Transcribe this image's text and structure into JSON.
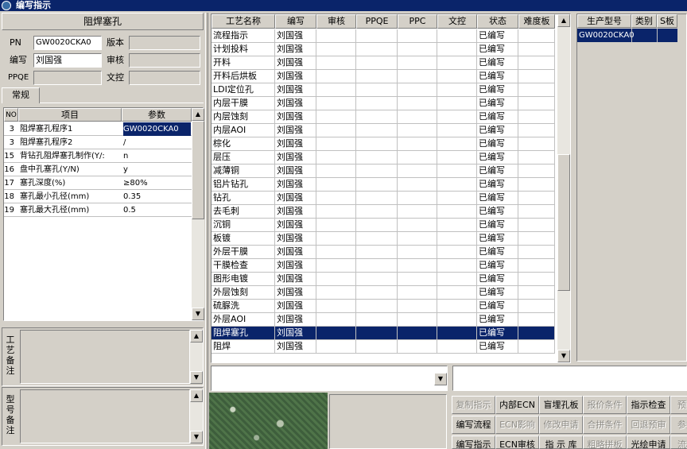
{
  "window": {
    "title": "编写指示"
  },
  "left": {
    "header": "阻焊塞孔",
    "fields": {
      "pn_label": "PN",
      "pn_value": "GW0020CKA0",
      "version_label": "版本",
      "version_value": "",
      "author_label": "编写",
      "author_value": "刘国强",
      "review_label": "审核",
      "review_value": "",
      "ppqe_label": "PPQE",
      "ppqe_value": "",
      "doc_label": "文控",
      "doc_value": ""
    },
    "tab": "常规",
    "param_table": {
      "headers": [
        "NO",
        "项目",
        "参数"
      ],
      "rows": [
        {
          "no": "3",
          "item": "阻焊塞孔程序1",
          "value": "GW0020CKA0"
        },
        {
          "no": "3",
          "item": "阻焊塞孔程序2",
          "value": "/"
        },
        {
          "no": "15",
          "item": "背钻孔阻焊塞孔制作(Y/:",
          "value": "n"
        },
        {
          "no": "16",
          "item": "盘中孔塞孔(Y/N)",
          "value": "y"
        },
        {
          "no": "17",
          "item": "塞孔深度(%)",
          "value": "≥80%"
        },
        {
          "no": "18",
          "item": "塞孔最小孔径(mm)",
          "value": "0.35"
        },
        {
          "no": "19",
          "item": "塞孔最大孔径(mm)",
          "value": "0.5"
        }
      ]
    },
    "process_remark_label": "工艺备注",
    "model_remark_label": "型号备注"
  },
  "process_grid": {
    "headers": [
      "工艺名称",
      "编写",
      "审核",
      "PPQE",
      "PPC",
      "文控",
      "状态",
      "难度板"
    ],
    "rows": [
      {
        "name": "流程指示",
        "author": "刘国强",
        "status": "已编写"
      },
      {
        "name": "计划投料",
        "author": "刘国强",
        "status": "已编写"
      },
      {
        "name": "开料",
        "author": "刘国强",
        "status": "已编写"
      },
      {
        "name": "开料后烘板",
        "author": "刘国强",
        "status": "已编写"
      },
      {
        "name": "LDI定位孔",
        "author": "刘国强",
        "status": "已编写"
      },
      {
        "name": "内层干膜",
        "author": "刘国强",
        "status": "已编写"
      },
      {
        "name": "内层蚀刻",
        "author": "刘国强",
        "status": "已编写"
      },
      {
        "name": "内层AOI",
        "author": "刘国强",
        "status": "已编写"
      },
      {
        "name": "棕化",
        "author": "刘国强",
        "status": "已编写"
      },
      {
        "name": "层压",
        "author": "刘国强",
        "status": "已编写"
      },
      {
        "name": "减薄铜",
        "author": "刘国强",
        "status": "已编写"
      },
      {
        "name": "铝片钻孔",
        "author": "刘国强",
        "status": "已编写"
      },
      {
        "name": "钻孔",
        "author": "刘国强",
        "status": "已编写"
      },
      {
        "name": "去毛刺",
        "author": "刘国强",
        "status": "已编写"
      },
      {
        "name": "沉铜",
        "author": "刘国强",
        "status": "已编写"
      },
      {
        "name": "板镀",
        "author": "刘国强",
        "status": "已编写"
      },
      {
        "name": "外层干膜",
        "author": "刘国强",
        "status": "已编写"
      },
      {
        "name": "干膜检查",
        "author": "刘国强",
        "status": "已编写"
      },
      {
        "name": "图形电镀",
        "author": "刘国强",
        "status": "已编写"
      },
      {
        "name": "外层蚀刻",
        "author": "刘国强",
        "status": "已编写"
      },
      {
        "name": "硫脲洗",
        "author": "刘国强",
        "status": "已编写"
      },
      {
        "name": "外层AOI",
        "author": "刘国强",
        "status": "已编写"
      },
      {
        "name": "阻焊塞孔",
        "author": "刘国强",
        "status": "已编写"
      },
      {
        "name": "阻焊",
        "author": "刘国强",
        "status": "已编写"
      }
    ],
    "selected_index": 22
  },
  "model_grid": {
    "headers": [
      "生产型号",
      "类别",
      "S板"
    ],
    "rows": [
      {
        "model": "GW0020CKA0",
        "category": "",
        "sboard": ""
      }
    ]
  },
  "buttons": {
    "row1": [
      "复制指示",
      "内部ECN",
      "盲埋孔板",
      "报价条件",
      "指示检查",
      "预审"
    ],
    "row2": [
      "编写流程",
      "ECN影响",
      "修改申请",
      "合拼条件",
      "回退预审",
      "参数"
    ],
    "row3": [
      "编写指示",
      "ECN审核",
      "指 示 库",
      "粗略拼板",
      "光绘申请",
      "流程"
    ]
  },
  "icons": {
    "app": "app-icon",
    "arrow_up": "▲",
    "arrow_down": "▼"
  }
}
